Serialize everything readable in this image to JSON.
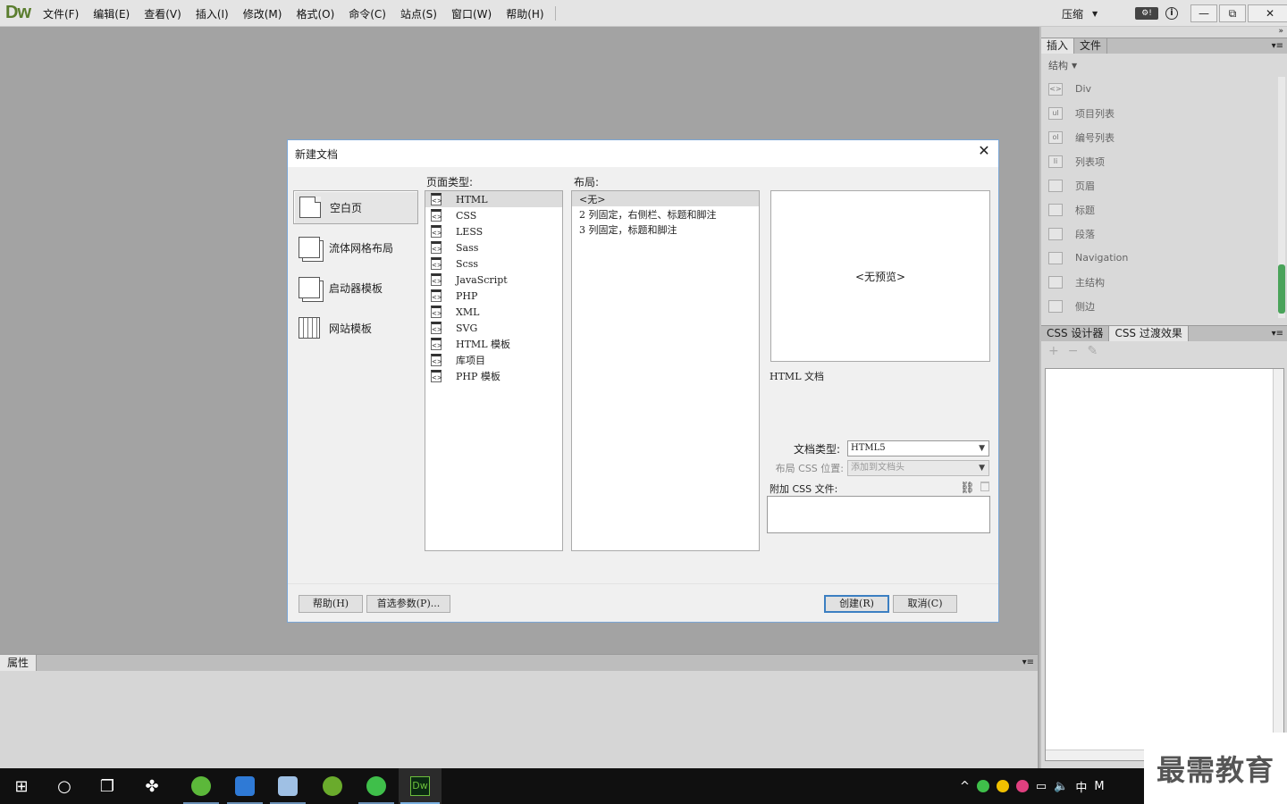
{
  "app": {
    "logo": "Dw"
  },
  "menu": [
    "文件(F)",
    "编辑(E)",
    "查看(V)",
    "插入(I)",
    "修改(M)",
    "格式(O)",
    "命令(C)",
    "站点(S)",
    "窗口(W)",
    "帮助(H)"
  ],
  "toolbar": {
    "compress_label": "压缩",
    "gear_label": "⚙!",
    "info_label": "i",
    "minimize": "—",
    "restore": "⧉",
    "close": "✕"
  },
  "insert_panel": {
    "tabs": [
      "插入",
      "文件"
    ],
    "category": "结构",
    "items": [
      {
        "icon": "<>",
        "label": "Div"
      },
      {
        "icon": "ul",
        "label": "项目列表"
      },
      {
        "icon": "ol",
        "label": "编号列表"
      },
      {
        "icon": "li",
        "label": "列表项"
      },
      {
        "icon": "",
        "label": "页眉"
      },
      {
        "icon": "",
        "label": "标题"
      },
      {
        "icon": "",
        "label": "段落"
      },
      {
        "icon": "",
        "label": "Navigation"
      },
      {
        "icon": "",
        "label": "主结构"
      },
      {
        "icon": "",
        "label": "侧边"
      }
    ]
  },
  "css_panel": {
    "tabs": [
      "CSS 设计器",
      "CSS 过渡效果"
    ],
    "tools": [
      "+",
      "−",
      "✎"
    ]
  },
  "properties_panel": {
    "tab": "属性"
  },
  "dialog": {
    "title": "新建文档",
    "close": "✕",
    "categories": [
      "空白页",
      "流体网格布局",
      "启动器模板",
      "网站模板"
    ],
    "page_type_label": "页面类型:",
    "page_types": [
      "HTML",
      "CSS",
      "LESS",
      "Sass",
      "Scss",
      "JavaScript",
      "PHP",
      "XML",
      "SVG",
      "HTML 模板",
      "库项目",
      "PHP 模板"
    ],
    "layout_label": "布局:",
    "layouts": [
      "<无>",
      "2 列固定，右侧栏、标题和脚注",
      "3 列固定，标题和脚注"
    ],
    "preview_text": "<无预览>",
    "description": "HTML 文档",
    "doctype_label": "文档类型:",
    "doctype_value": "HTML5",
    "layout_css_label": "布局 CSS 位置:",
    "layout_css_value": "添加到文档头",
    "attach_css_label": "附加 CSS 文件:",
    "buttons": {
      "help": "帮助(H)",
      "prefs": "首选参数(P)...",
      "create": "创建(R)",
      "cancel": "取消(C)"
    }
  },
  "taskbar": {
    "tray_ime": "中",
    "tray_m": "M"
  },
  "watermark": "最需教育",
  "colors": {
    "dw_green": "#5a7d2e",
    "dialog_border": "#7aa6d6",
    "default_button": "#3c7fc2",
    "scroll_thumb": "#4aa35a"
  }
}
